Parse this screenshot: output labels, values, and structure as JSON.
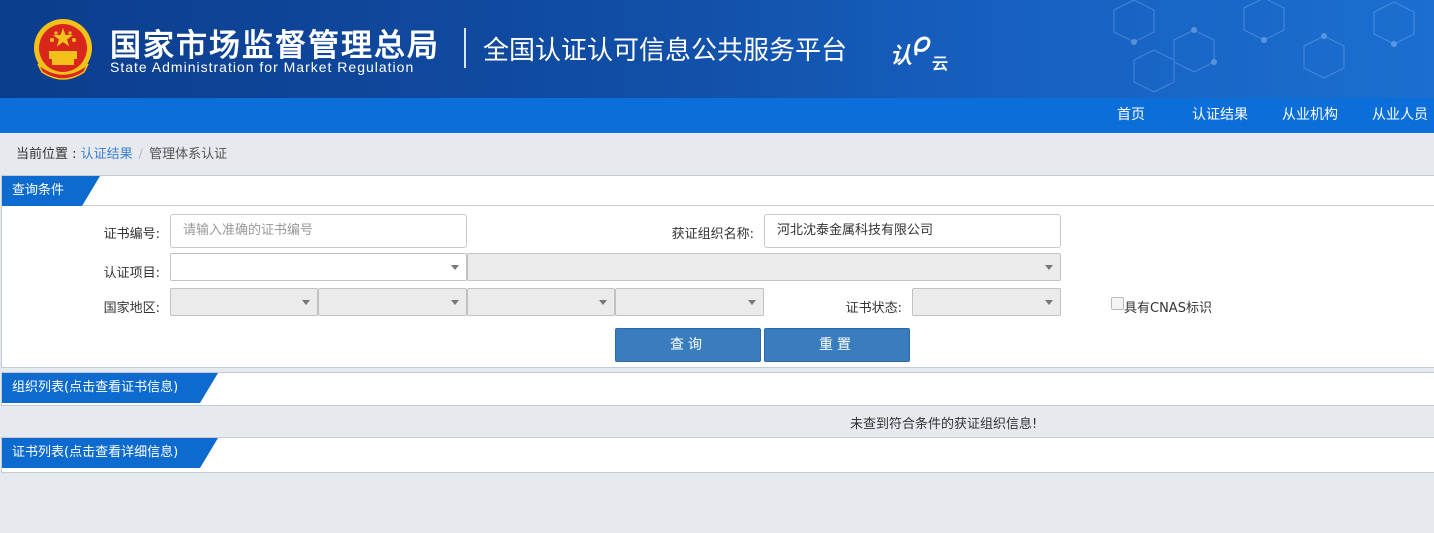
{
  "header": {
    "agency_cn": "国家市场监督管理总局",
    "agency_en": "State Administration  for  Market Regulation",
    "platform": "全国认证认可信息公共服务平台",
    "logo_text_1": "认",
    "logo_text_2": "云",
    "emblem_icon": "national-emblem-icon",
    "brand_color": "#114ea6"
  },
  "nav": {
    "items": [
      {
        "label": "首页"
      },
      {
        "label": "认证结果"
      },
      {
        "label": "从业机构"
      },
      {
        "label": "从业人员"
      }
    ],
    "color": "#0c6ed9"
  },
  "breadcrumb": {
    "prefix": "当前位置 : ",
    "link": "认证结果",
    "separator": "/",
    "current": "管理体系认证"
  },
  "query_panel": {
    "title": "查询条件",
    "cert_no_label": "证书编号:",
    "cert_no_placeholder": "请输入准确的证书编号",
    "org_name_label": "获证组织名称:",
    "org_name_value": "河北沈泰金属科技有限公司",
    "project_label": "认证项目:",
    "region_label": "国家地区:",
    "status_label": "证书状态:",
    "cnas_label": "具有CNAS标识",
    "search_button": "查询",
    "reset_button": "重置"
  },
  "org_panel": {
    "title": "组织列表(点击查看证书信息)",
    "empty_message": "未查到符合条件的获证组织信息!"
  },
  "cert_panel": {
    "title": "证书列表(点击查看详细信息)"
  }
}
